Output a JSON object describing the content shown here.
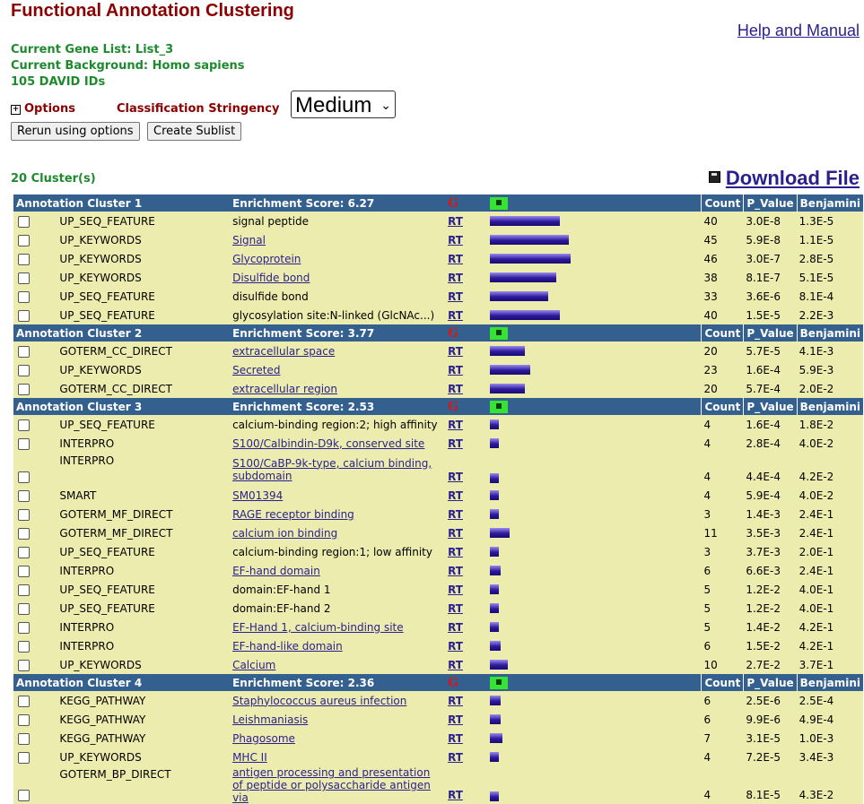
{
  "page": {
    "title": "Functional Annotation Clustering",
    "help_link": "Help and Manual",
    "gene_list": "Current Gene List: List_3",
    "background": "Current Background: Homo sapiens",
    "ids": "105 DAVID IDs",
    "options_label": "Options",
    "stringency_label": "Classification Stringency",
    "stringency_value": "Medium",
    "rerun_button": "Rerun using options",
    "sublist_button": "Create Sublist",
    "cluster_count": "20 Cluster(s)",
    "download_label": "Download File"
  },
  "table_header": {
    "count": "Count",
    "p_value": "P_Value",
    "benjamini": "Benjamini",
    "rt": "RT",
    "g": "G"
  },
  "clusters": [
    {
      "name": "Annotation Cluster 1",
      "score": "Enrichment Score: 6.27",
      "rows": [
        {
          "cat": "UP_SEQ_FEATURE",
          "term": "signal peptide",
          "link": false,
          "count": "40",
          "p": "3.0E-8",
          "b": "1.3E-5"
        },
        {
          "cat": "UP_KEYWORDS",
          "term": "Signal",
          "link": true,
          "count": "45",
          "p": "5.9E-8",
          "b": "1.1E-5"
        },
        {
          "cat": "UP_KEYWORDS",
          "term": "Glycoprotein",
          "link": true,
          "count": "46",
          "p": "3.0E-7",
          "b": "2.8E-5"
        },
        {
          "cat": "UP_KEYWORDS",
          "term": "Disulfide bond",
          "link": true,
          "count": "38",
          "p": "8.1E-7",
          "b": "5.1E-5"
        },
        {
          "cat": "UP_SEQ_FEATURE",
          "term": "disulfide bond",
          "link": false,
          "count": "33",
          "p": "3.6E-6",
          "b": "8.1E-4"
        },
        {
          "cat": "UP_SEQ_FEATURE",
          "term": "glycosylation site:N-linked (GlcNAc...)",
          "link": false,
          "count": "40",
          "p": "1.5E-5",
          "b": "2.2E-3"
        }
      ]
    },
    {
      "name": "Annotation Cluster 2",
      "score": "Enrichment Score: 3.77",
      "rows": [
        {
          "cat": "GOTERM_CC_DIRECT",
          "term": "extracellular space",
          "link": true,
          "count": "20",
          "p": "5.7E-5",
          "b": "4.1E-3"
        },
        {
          "cat": "UP_KEYWORDS",
          "term": "Secreted",
          "link": true,
          "count": "23",
          "p": "1.6E-4",
          "b": "5.9E-3"
        },
        {
          "cat": "GOTERM_CC_DIRECT",
          "term": "extracellular region",
          "link": true,
          "count": "20",
          "p": "5.7E-4",
          "b": "2.0E-2"
        }
      ]
    },
    {
      "name": "Annotation Cluster 3",
      "score": "Enrichment Score: 2.53",
      "rows": [
        {
          "cat": "UP_SEQ_FEATURE",
          "term": "calcium-binding region:2; high affinity",
          "link": false,
          "count": "4",
          "p": "1.6E-4",
          "b": "1.8E-2"
        },
        {
          "cat": "INTERPRO",
          "term": "S100/Calbindin-D9k, conserved site",
          "link": true,
          "count": "4",
          "p": "2.8E-4",
          "b": "4.0E-2"
        },
        {
          "cat": "INTERPRO",
          "term": "S100/CaBP-9k-type, calcium binding, subdomain",
          "link": true,
          "tall": true,
          "count": "4",
          "p": "4.4E-4",
          "b": "4.2E-2"
        },
        {
          "cat": "SMART",
          "term": "SM01394",
          "link": true,
          "count": "4",
          "p": "5.9E-4",
          "b": "4.0E-2"
        },
        {
          "cat": "GOTERM_MF_DIRECT",
          "term": "RAGE receptor binding",
          "link": true,
          "count": "3",
          "p": "1.4E-3",
          "b": "2.4E-1"
        },
        {
          "cat": "GOTERM_MF_DIRECT",
          "term": "calcium ion binding",
          "link": true,
          "count": "11",
          "p": "3.5E-3",
          "b": "2.4E-1"
        },
        {
          "cat": "UP_SEQ_FEATURE",
          "term": "calcium-binding region:1; low affinity",
          "link": false,
          "count": "3",
          "p": "3.7E-3",
          "b": "2.0E-1"
        },
        {
          "cat": "INTERPRO",
          "term": "EF-hand domain",
          "link": true,
          "count": "6",
          "p": "6.6E-3",
          "b": "2.4E-1"
        },
        {
          "cat": "UP_SEQ_FEATURE",
          "term": "domain:EF-hand 1",
          "link": false,
          "count": "5",
          "p": "1.2E-2",
          "b": "4.0E-1"
        },
        {
          "cat": "UP_SEQ_FEATURE",
          "term": "domain:EF-hand 2",
          "link": false,
          "count": "5",
          "p": "1.2E-2",
          "b": "4.0E-1"
        },
        {
          "cat": "INTERPRO",
          "term": "EF-Hand 1, calcium-binding site",
          "link": true,
          "count": "5",
          "p": "1.4E-2",
          "b": "4.2E-1"
        },
        {
          "cat": "INTERPRO",
          "term": "EF-hand-like domain",
          "link": true,
          "count": "6",
          "p": "1.5E-2",
          "b": "4.2E-1"
        },
        {
          "cat": "UP_KEYWORDS",
          "term": "Calcium",
          "link": true,
          "count": "10",
          "p": "2.7E-2",
          "b": "3.7E-1"
        }
      ]
    },
    {
      "name": "Annotation Cluster 4",
      "score": "Enrichment Score: 2.36",
      "rows": [
        {
          "cat": "KEGG_PATHWAY",
          "term": "Staphylococcus aureus infection",
          "link": true,
          "count": "6",
          "p": "2.5E-6",
          "b": "2.5E-4"
        },
        {
          "cat": "KEGG_PATHWAY",
          "term": "Leishmaniasis",
          "link": true,
          "count": "6",
          "p": "9.9E-6",
          "b": "4.9E-4"
        },
        {
          "cat": "KEGG_PATHWAY",
          "term": "Phagosome",
          "link": true,
          "count": "7",
          "p": "3.1E-5",
          "b": "1.0E-3"
        },
        {
          "cat": "UP_KEYWORDS",
          "term": "MHC II",
          "link": true,
          "count": "4",
          "p": "7.2E-5",
          "b": "3.4E-3"
        },
        {
          "cat": "GOTERM_BP_DIRECT",
          "term": "antigen processing and presentation of peptide or polysaccharide antigen via",
          "link": true,
          "tall": true,
          "count": "4",
          "p": "8.1E-5",
          "b": "4.3E-2"
        }
      ]
    }
  ]
}
